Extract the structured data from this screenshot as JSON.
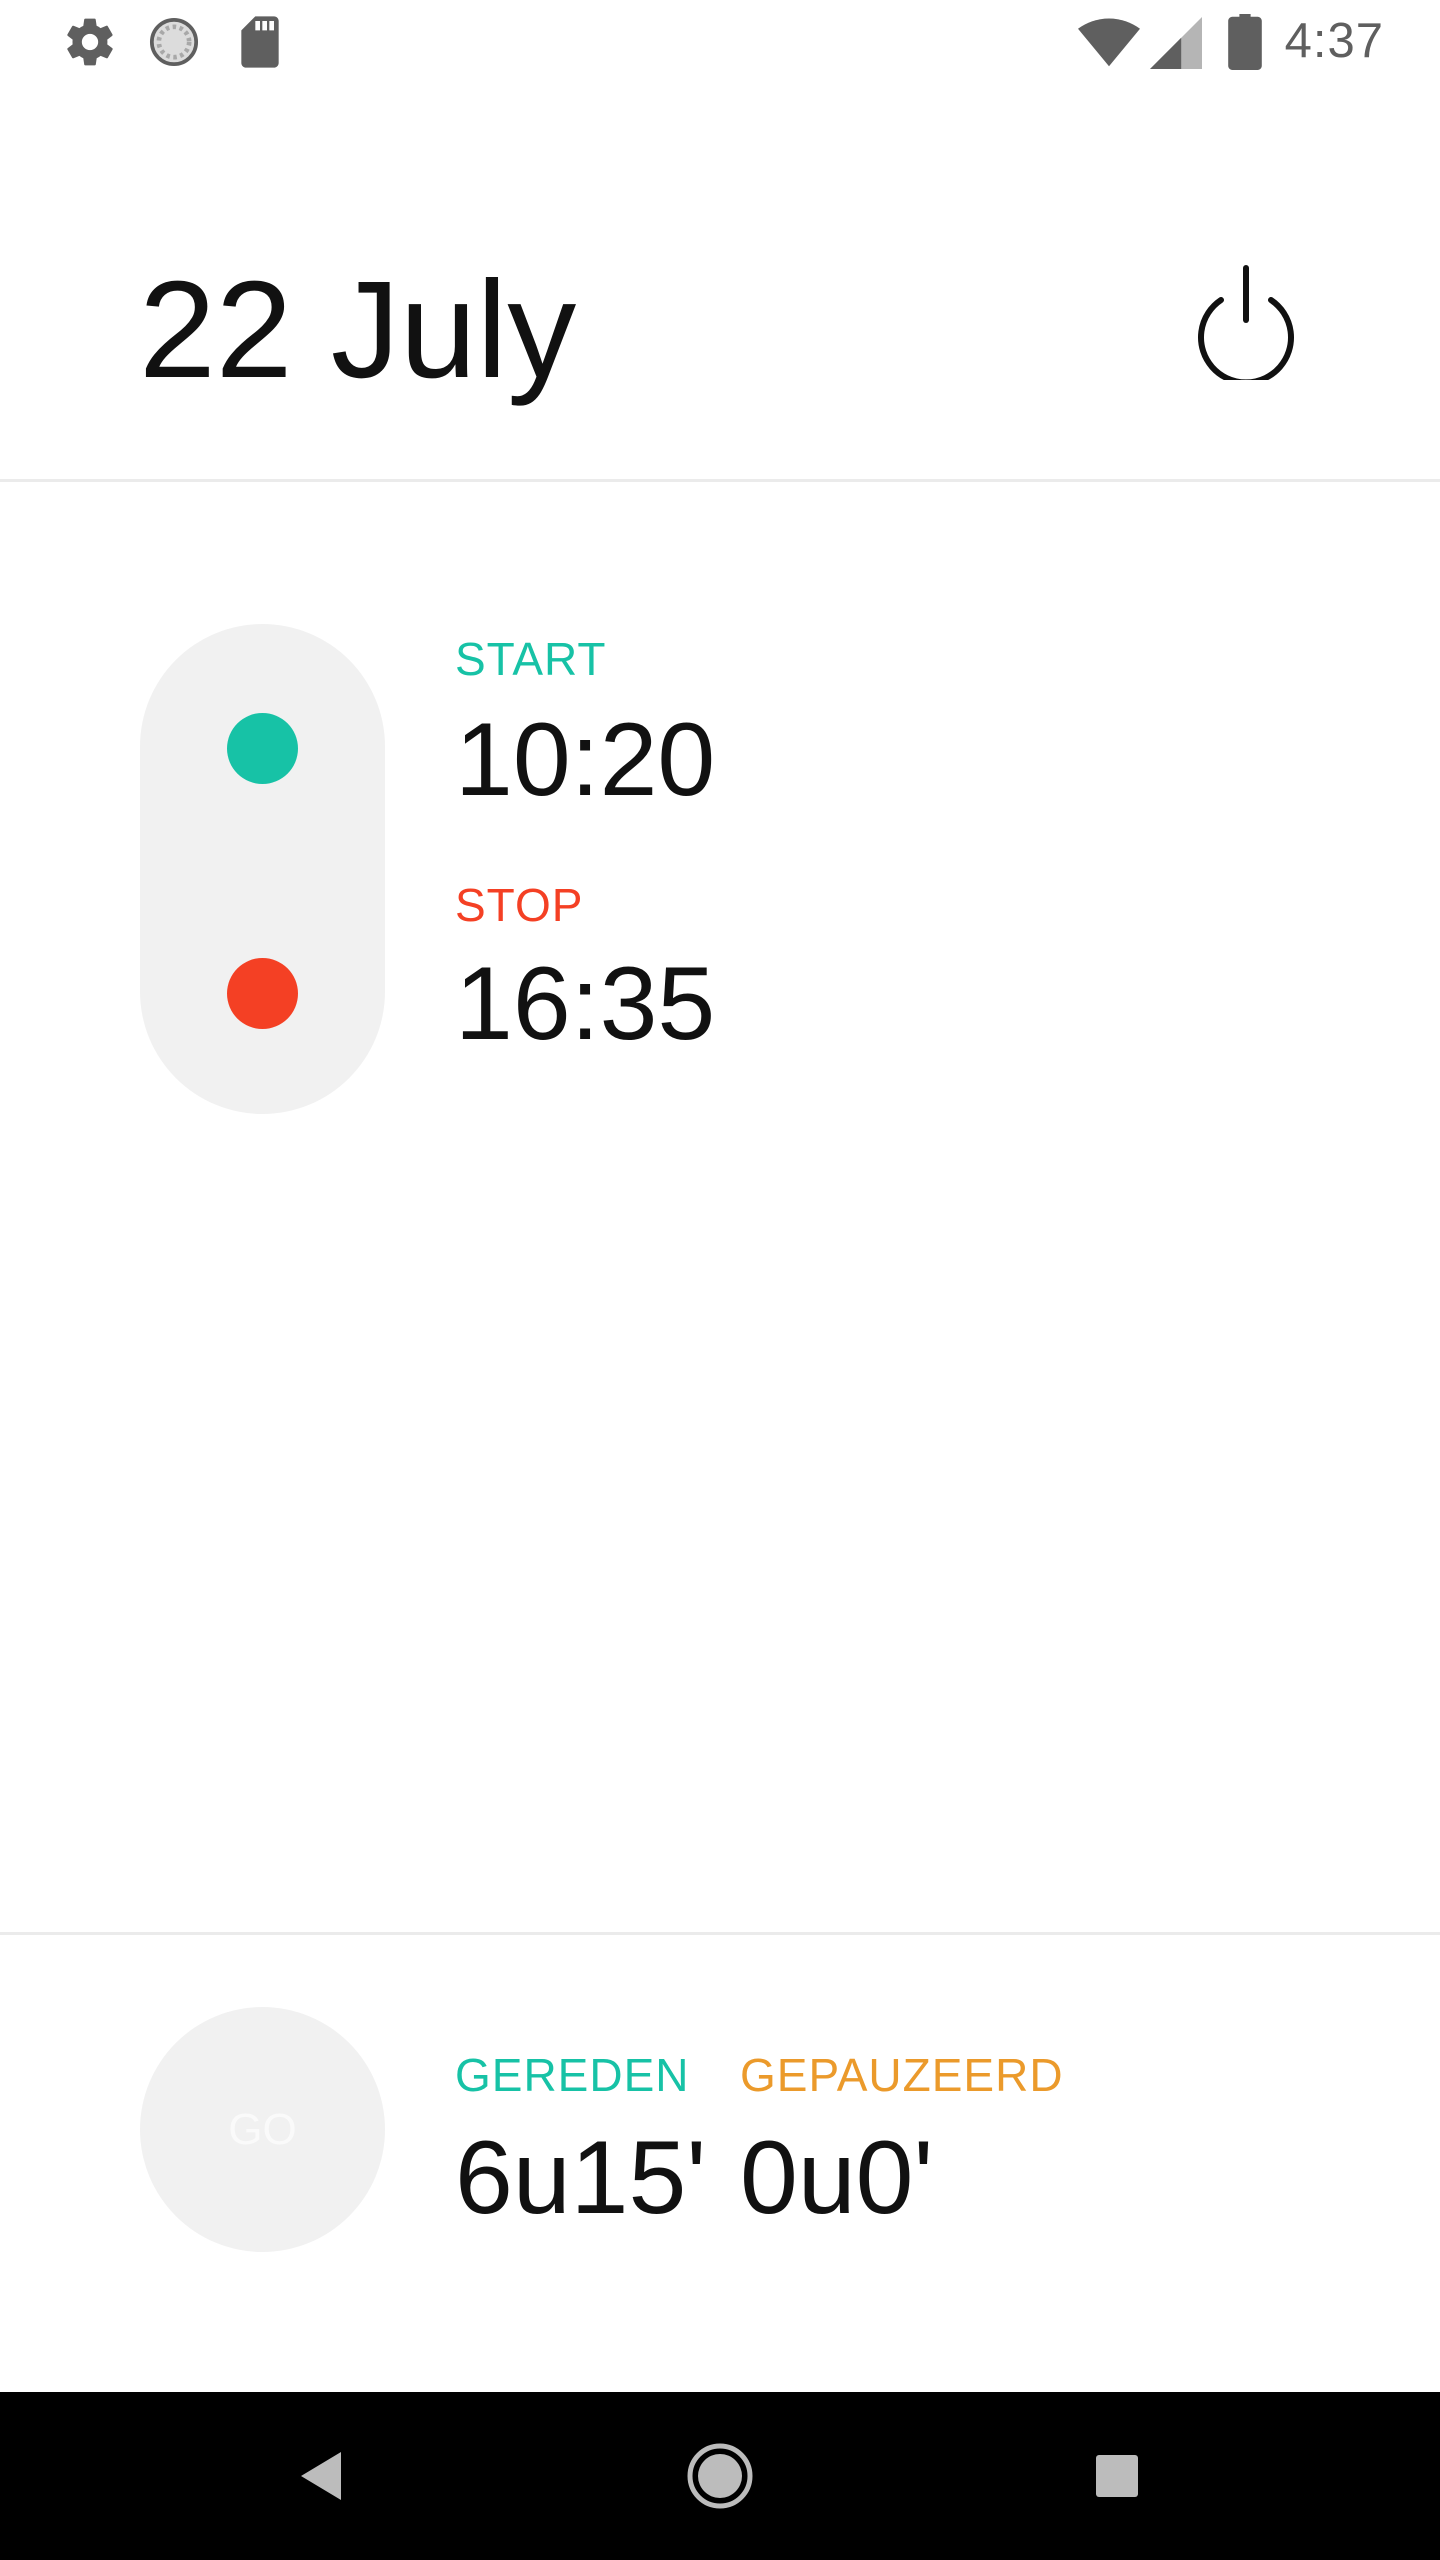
{
  "status_bar": {
    "time": "4:37",
    "left_icons": [
      "gear-icon",
      "sync-icon",
      "sd-card-icon"
    ],
    "right_icons": [
      "wifi-icon",
      "signal-icon",
      "battery-icon"
    ]
  },
  "header": {
    "date": "22 July",
    "power_icon": "power-icon"
  },
  "times": {
    "start": {
      "label": "START",
      "value": "10:20",
      "color": "#17c2a6"
    },
    "stop": {
      "label": "STOP",
      "value": "16:35",
      "color": "#f44024"
    }
  },
  "summary": {
    "go_label": "GO",
    "driven": {
      "label": "GEREDEN",
      "value": "6u15'",
      "color": "#17c2a6"
    },
    "paused": {
      "label": "GEPAUZEERD",
      "value": "0u0'",
      "color": "#eb9a2b"
    }
  },
  "nav_bar": {
    "buttons": [
      "back-icon",
      "home-icon",
      "recents-icon"
    ]
  }
}
